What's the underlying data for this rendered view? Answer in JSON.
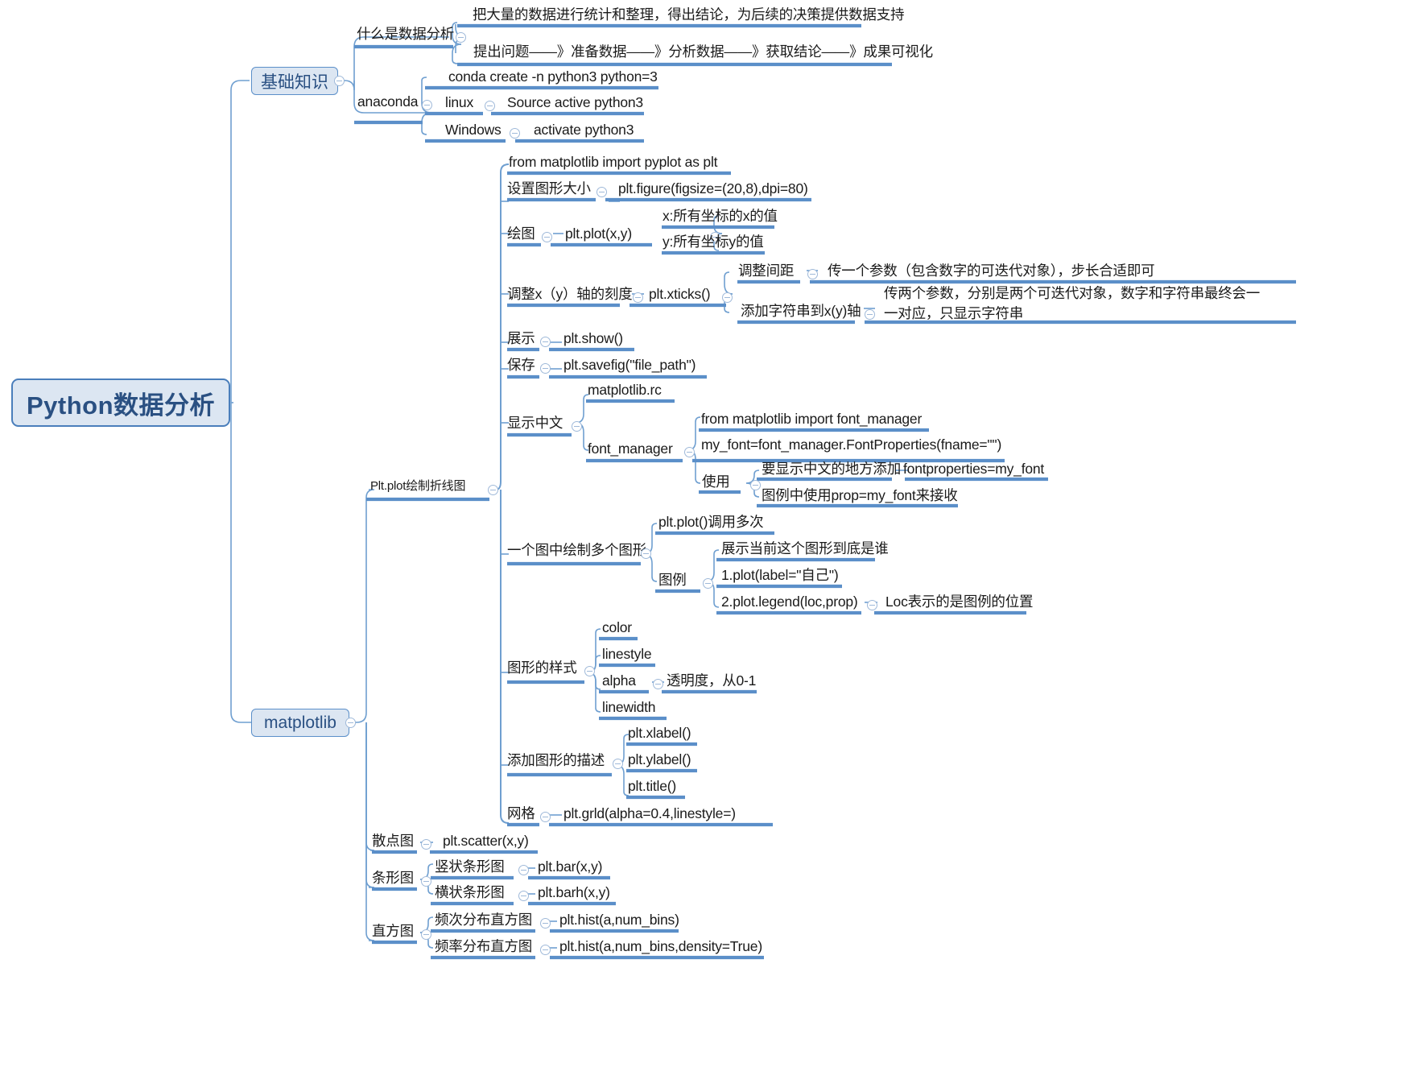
{
  "root": {
    "label": "Python数据分析"
  },
  "branches": [
    {
      "label": "基础知识",
      "children": [
        {
          "label": "什么是数据分析",
          "children": [
            {
              "label": "把大量的数据进行统计和整理，得出结论，为后续的决策提供数据支持"
            },
            {
              "label": "提出问题——》准备数据——》分析数据——》获取结论——》成果可视化"
            }
          ]
        },
        {
          "label": "anaconda",
          "children": [
            {
              "label": "conda create -n python3 python=3"
            },
            {
              "label": "linux",
              "children": [
                {
                  "label": "Source active python3"
                }
              ]
            },
            {
              "label": "Windows",
              "children": [
                {
                  "label": "activate python3"
                }
              ]
            }
          ]
        }
      ]
    },
    {
      "label": "matplotlib",
      "children": [
        {
          "label": "Plt.plot绘制折线图",
          "children": [
            {
              "label": "from matplotlib import pyplot as plt"
            },
            {
              "label": "设置图形大小",
              "children": [
                {
                  "label": "plt.figure(figsize=(20,8),dpi=80)"
                }
              ]
            },
            {
              "label": "绘图",
              "children": [
                {
                  "label": "plt.plot(x,y)",
                  "children": [
                    {
                      "label": "x:所有坐标的x的值"
                    },
                    {
                      "label": "y:所有坐标y的值"
                    }
                  ]
                }
              ]
            },
            {
              "label": "调整x（y）轴的刻度",
              "children": [
                {
                  "label": "plt.xticks()",
                  "children": [
                    {
                      "label": "调整间距",
                      "children": [
                        {
                          "label": "传一个参数（包含数字的可迭代对象），步长合适即可"
                        }
                      ]
                    },
                    {
                      "label": "添加字符串到x(y)轴",
                      "children": [
                        {
                          "label": "传两个参数，分别是两个可迭代对象，数字和字符串最终会一一对应，只显示字符串"
                        }
                      ]
                    }
                  ]
                }
              ]
            },
            {
              "label": "展示",
              "children": [
                {
                  "label": "plt.show()"
                }
              ]
            },
            {
              "label": "保存",
              "children": [
                {
                  "label": "plt.savefig(\"file_path\")"
                }
              ]
            },
            {
              "label": "显示中文",
              "children": [
                {
                  "label": "matplotlib.rc"
                },
                {
                  "label": "font_manager",
                  "children": [
                    {
                      "label": "from matplotlib import font_manager"
                    },
                    {
                      "label": "my_font=font_manager.FontProperties(fname=\"\")"
                    },
                    {
                      "label": "使用",
                      "children": [
                        {
                          "label": "要显示中文的地方添加",
                          "children": [
                            {
                              "label": "fontproperties=my_font"
                            }
                          ]
                        },
                        {
                          "label": "图例中使用prop=my_font来接收"
                        }
                      ]
                    }
                  ]
                }
              ]
            },
            {
              "label": "一个图中绘制多个图形",
              "children": [
                {
                  "label": "plt.plot()调用多次"
                },
                {
                  "label": "图例",
                  "children": [
                    {
                      "label": "展示当前这个图形到底是谁"
                    },
                    {
                      "label": "1.plot(label=\"自己\")"
                    },
                    {
                      "label": "2.plot.legend(loc,prop)",
                      "children": [
                        {
                          "label": "Loc表示的是图例的位置"
                        }
                      ]
                    }
                  ]
                }
              ]
            },
            {
              "label": "图形的样式",
              "children": [
                {
                  "label": "color"
                },
                {
                  "label": "linestyle"
                },
                {
                  "label": "alpha",
                  "children": [
                    {
                      "label": "透明度，从0-1"
                    }
                  ]
                },
                {
                  "label": "linewidth"
                }
              ]
            },
            {
              "label": "添加图形的描述",
              "children": [
                {
                  "label": "plt.xlabel()"
                },
                {
                  "label": "plt.ylabel()"
                },
                {
                  "label": "plt.title()"
                }
              ]
            },
            {
              "label": "网格",
              "children": [
                {
                  "label": "plt.grld(alpha=0.4,linestyle=)"
                }
              ]
            }
          ]
        },
        {
          "label": "散点图",
          "children": [
            {
              "label": "plt.scatter(x,y)"
            }
          ]
        },
        {
          "label": "条形图",
          "children": [
            {
              "label": "竖状条形图",
              "children": [
                {
                  "label": "plt.bar(x,y)"
                }
              ]
            },
            {
              "label": "横状条形图",
              "children": [
                {
                  "label": "plt.barh(x,y)"
                }
              ]
            }
          ]
        },
        {
          "label": "直方图",
          "children": [
            {
              "label": "频次分布直方图",
              "children": [
                {
                  "label": "plt.hist(a,num_bins)"
                }
              ]
            },
            {
              "label": "频率分布直方图",
              "children": [
                {
                  "label": "plt.hist(a,num_bins,density=True)"
                }
              ]
            }
          ]
        }
      ]
    }
  ],
  "nodes": {
    "n_what_is_da": "什么是数据分析",
    "n_what_is_da_1": "把大量的数据进行统计和整理，得出结论，为后续的决策提供数据支持",
    "n_what_is_da_2": "提出问题——》准备数据——》分析数据——》获取结论——》成果可视化",
    "n_anaconda": "anaconda",
    "n_conda_create": "conda create -n python3 python=3",
    "n_linux": "linux",
    "n_linux_cmd": "Source active python3",
    "n_windows": "Windows",
    "n_windows_cmd": "activate python3",
    "n_basic": "基础知识",
    "n_matplotlib": "matplotlib",
    "n_pltplot": "Plt.plot绘制折线图",
    "n_import": "from matplotlib import pyplot as plt",
    "n_figsize": "设置图形大小",
    "n_figsize_code": "plt.figure(figsize=(20,8),dpi=80)",
    "n_draw": "绘图",
    "n_draw_code": "plt.plot(x,y)",
    "n_draw_x": "x:所有坐标的x的值",
    "n_draw_y": "y:所有坐标y的值",
    "n_ticks": "调整x（y）轴的刻度",
    "n_ticks_code": "plt.xticks()",
    "n_ticks_gap": "调整间距",
    "n_ticks_gap_desc": "传一个参数（包含数字的可迭代对象），步长合适即可",
    "n_ticks_str": "添加字符串到x(y)轴",
    "n_ticks_str_desc": "传两个参数，分别是两个可迭代对象，数字和字符串最终会一一对应，只显示字符串",
    "n_show": "展示",
    "n_show_code": "plt.show()",
    "n_save": "保存",
    "n_save_code": "plt.savefig(\"file_path\")",
    "n_cn": "显示中文",
    "n_cn_rc": "matplotlib.rc",
    "n_cn_fm": "font_manager",
    "n_cn_fm_import": "from matplotlib import font_manager",
    "n_cn_fm_my": "my_font=font_manager.FontProperties(fname=\"\")",
    "n_cn_use": "使用",
    "n_cn_use_1": "要显示中文的地方添加",
    "n_cn_use_1b": "fontproperties=my_font",
    "n_cn_use_2": "图例中使用prop=my_font来接收",
    "n_multi": "一个图中绘制多个图形",
    "n_multi_1": "plt.plot()调用多次",
    "n_legend": "图例",
    "n_legend_1": "展示当前这个图形到底是谁",
    "n_legend_2": "1.plot(label=\"自己\")",
    "n_legend_3": "2.plot.legend(loc,prop)",
    "n_legend_3b": "Loc表示的是图例的位置",
    "n_style": "图形的样式",
    "n_style_color": "color",
    "n_style_linestyle": "linestyle",
    "n_style_alpha": "alpha",
    "n_style_alpha_desc": "透明度，从0-1",
    "n_style_linewidth": "linewidth",
    "n_desc": "添加图形的描述",
    "n_desc_x": "plt.xlabel()",
    "n_desc_y": "plt.ylabel()",
    "n_desc_t": "plt.title()",
    "n_grid": "网格",
    "n_grid_code": "plt.grld(alpha=0.4,linestyle=)",
    "n_scatter": "散点图",
    "n_scatter_code": "plt.scatter(x,y)",
    "n_bar": "条形图",
    "n_bar_v": "竖状条形图",
    "n_bar_v_code": "plt.bar(x,y)",
    "n_bar_h": "横状条形图",
    "n_bar_h_code": "plt.barh(x,y)",
    "n_hist": "直方图",
    "n_hist_f1": "频次分布直方图",
    "n_hist_f1_code": "plt.hist(a,num_bins)",
    "n_hist_f2": "频率分布直方图",
    "n_hist_f2_code": "plt.hist(a,num_bins,density=True)"
  },
  "colors": {
    "underline": "#5b8fc9",
    "connector": "#6f9fd0",
    "node_fill": "#dce6f2",
    "node_border": "#4a7ebb",
    "root_text": "#2a5082",
    "text": "#1a1a1a"
  }
}
